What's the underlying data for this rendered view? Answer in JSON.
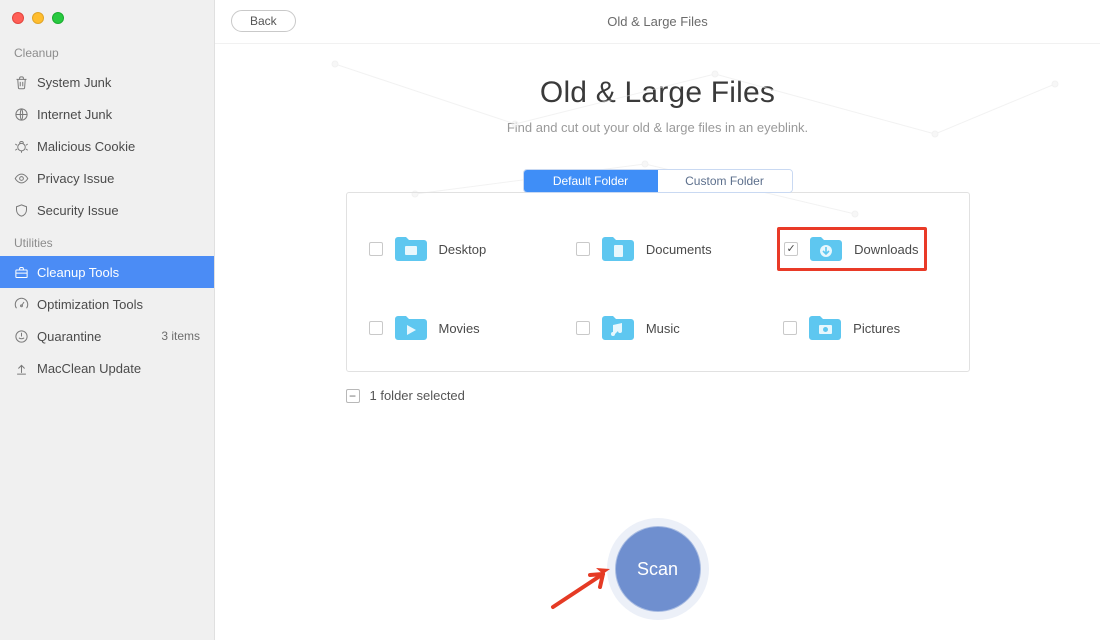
{
  "header": {
    "back_label": "Back",
    "title": "Old & Large Files"
  },
  "hero": {
    "title": "Old & Large Files",
    "subtitle": "Find and cut out your old & large files in an eyeblink."
  },
  "tabs": {
    "default": "Default Folder",
    "custom": "Custom Folder",
    "active": "default"
  },
  "folders": [
    {
      "key": "desktop",
      "label": "Desktop",
      "checked": false
    },
    {
      "key": "documents",
      "label": "Documents",
      "checked": false
    },
    {
      "key": "downloads",
      "label": "Downloads",
      "checked": true
    },
    {
      "key": "movies",
      "label": "Movies",
      "checked": false
    },
    {
      "key": "music",
      "label": "Music",
      "checked": false
    },
    {
      "key": "pictures",
      "label": "Pictures",
      "checked": false
    }
  ],
  "selection_summary": "1 folder selected",
  "scan_label": "Scan",
  "sidebar": {
    "sections": {
      "cleanup": {
        "title": "Cleanup",
        "items": [
          {
            "label": "System Junk"
          },
          {
            "label": "Internet Junk"
          },
          {
            "label": "Malicious Cookie"
          },
          {
            "label": "Privacy Issue"
          },
          {
            "label": "Security Issue"
          }
        ]
      },
      "utilities": {
        "title": "Utilities",
        "items": [
          {
            "label": "Cleanup Tools",
            "selected": true
          },
          {
            "label": "Optimization Tools"
          },
          {
            "label": "Quarantine",
            "badge": "3 items"
          },
          {
            "label": "MacClean Update"
          }
        ]
      }
    }
  },
  "colors": {
    "accent": "#3f8ef7",
    "scan": "#6f8fcf",
    "highlight": "#e93a27",
    "folder": "#5ec7f0"
  }
}
